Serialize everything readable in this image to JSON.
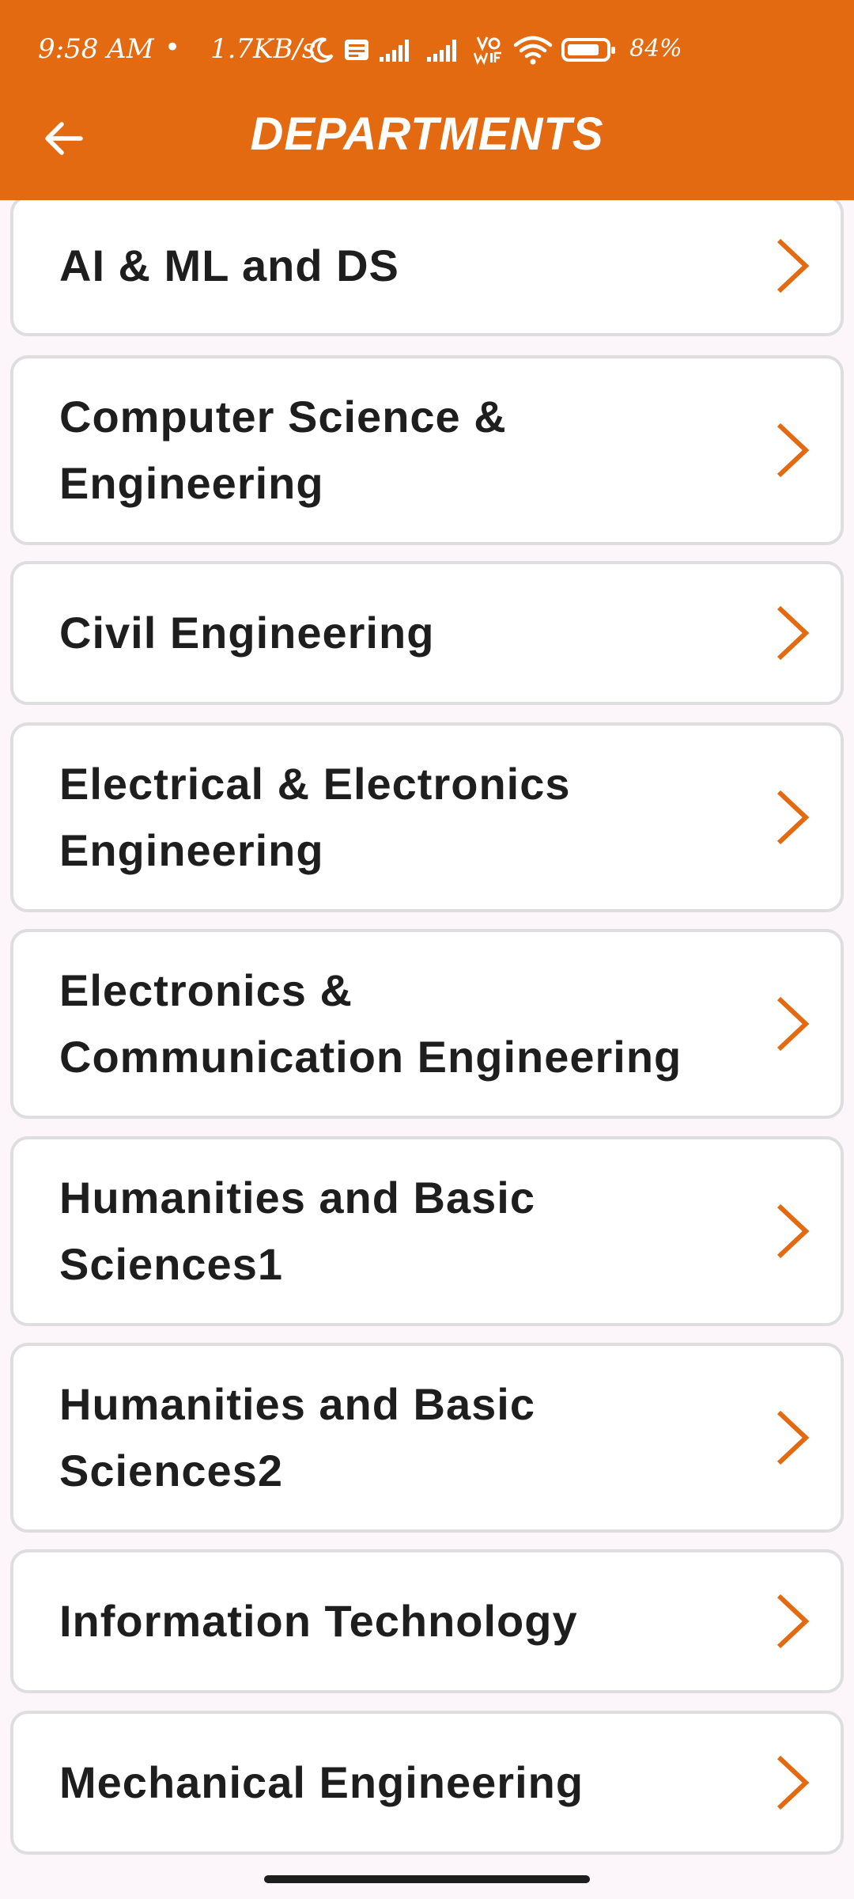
{
  "status_bar": {
    "time": "9:58 AM",
    "dot": "•",
    "speed": "1.7KB/s",
    "battery_percent": "84%",
    "battery_level": 0.84,
    "icons": [
      "moon-icon",
      "volte-icon",
      "signal-icon",
      "signal-icon",
      "vowifi-icon",
      "wifi-icon",
      "battery-icon"
    ]
  },
  "header": {
    "title": "DEPARTMENTS",
    "back_icon": "arrow-left-icon"
  },
  "departments": [
    {
      "label": "AI & ML and DS"
    },
    {
      "label": "Computer Science & Engineering"
    },
    {
      "label": "Civil Engineering"
    },
    {
      "label": "Electrical & Electronics Engineering"
    },
    {
      "label": "Electronics & Communication Engineering"
    },
    {
      "label": "Humanities and Basic Sciences1"
    },
    {
      "label": "Humanities and Basic Sciences2"
    },
    {
      "label": "Information Technology"
    },
    {
      "label": "Mechanical Engineering"
    }
  ],
  "colors": {
    "accent": "#e36a10",
    "background": "#fcf6fb",
    "card": "#ffffff",
    "card_border": "#dedede",
    "text": "#1e1e1e"
  }
}
